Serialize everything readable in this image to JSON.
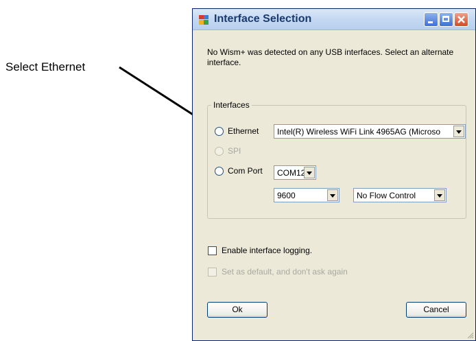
{
  "annotation": {
    "text": "Select Ethernet"
  },
  "window": {
    "title": "Interface Selection"
  },
  "message": "No Wism+ was detected on any USB interfaces. Select an alternate interface.",
  "interfaces": {
    "group_label": "Interfaces",
    "ethernet": {
      "label": "Ethernet",
      "selected_value": "Intel(R) Wireless WiFi Link 4965AG (Microso"
    },
    "spi": {
      "label": "SPI"
    },
    "comport": {
      "label": "Com Port",
      "port_value": "COM12",
      "baud_value": "9600",
      "flow_value": "No Flow Control"
    }
  },
  "options": {
    "logging_label": "Enable interface logging.",
    "default_label": "Set as default, and don't ask again"
  },
  "buttons": {
    "ok": "Ok",
    "cancel": "Cancel"
  }
}
